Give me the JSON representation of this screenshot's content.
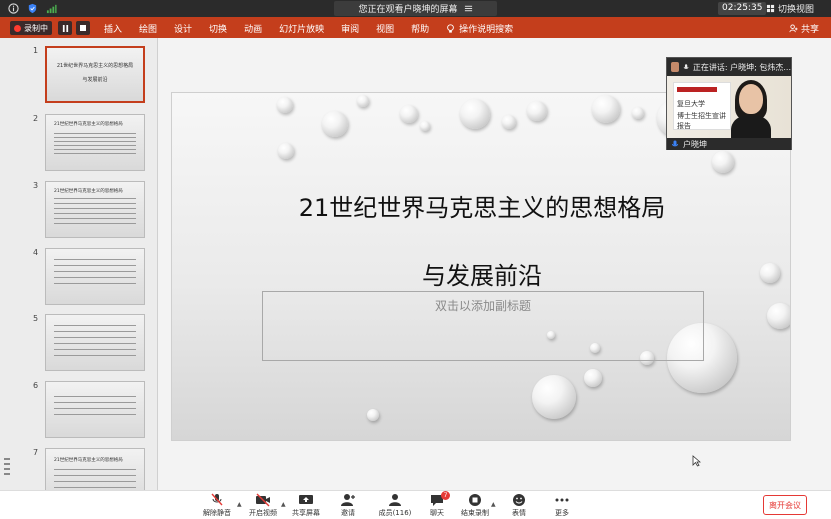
{
  "topbar": {
    "sharing_text": "您正在观看户晓坤的屏幕",
    "time": "02:25:35",
    "switch_view": "切换视图"
  },
  "ribbon": {
    "recording_label": "录制中",
    "tabs": [
      "插入",
      "绘图",
      "设计",
      "切换",
      "动画",
      "幻灯片放映",
      "审阅",
      "视图",
      "帮助",
      "操作说明搜索"
    ],
    "share_label": "共享",
    "accent": "#c43e1c"
  },
  "thumbnails": [
    {
      "num": "1",
      "title": "21世纪世界马克思主义的思想格局",
      "subtitle": "与发展前沿"
    },
    {
      "num": "2",
      "title": "21世纪世界马克思主义的思想格局"
    },
    {
      "num": "3",
      "title": "21世纪世界马克思主义的思想格局"
    },
    {
      "num": "4",
      "title": ""
    },
    {
      "num": "5",
      "title": ""
    },
    {
      "num": "6",
      "title": ""
    },
    {
      "num": "7",
      "title": "21世纪世界马克思主义的思想格局"
    }
  ],
  "slide": {
    "title_line1": "21世纪世界马克思主义的思想格局",
    "title_line2": "与发展前沿",
    "subtitle_placeholder": "双击以添加副标题"
  },
  "video": {
    "speaking_label": "正在讲话: 户晓坤; 包炜杰...",
    "participant_name": "户晓坤",
    "banner_line1": "复旦大学",
    "banner_line2": "博士生招生宣讲报告"
  },
  "toolbar": {
    "items": [
      {
        "label": "解除静音",
        "icon": "mic-muted-icon"
      },
      {
        "label": "开启视频",
        "icon": "video-off-icon"
      },
      {
        "label": "共享屏幕",
        "icon": "share-screen-icon"
      },
      {
        "label": "邀请",
        "icon": "invite-icon"
      },
      {
        "label": "成员(116)",
        "icon": "members-icon"
      },
      {
        "label": "聊天",
        "icon": "chat-icon",
        "badge": "7"
      },
      {
        "label": "结束录制",
        "icon": "stop-record-icon"
      },
      {
        "label": "表情",
        "icon": "emoji-icon"
      },
      {
        "label": "更多",
        "icon": "more-icon"
      }
    ],
    "leave_label": "离开会议"
  }
}
